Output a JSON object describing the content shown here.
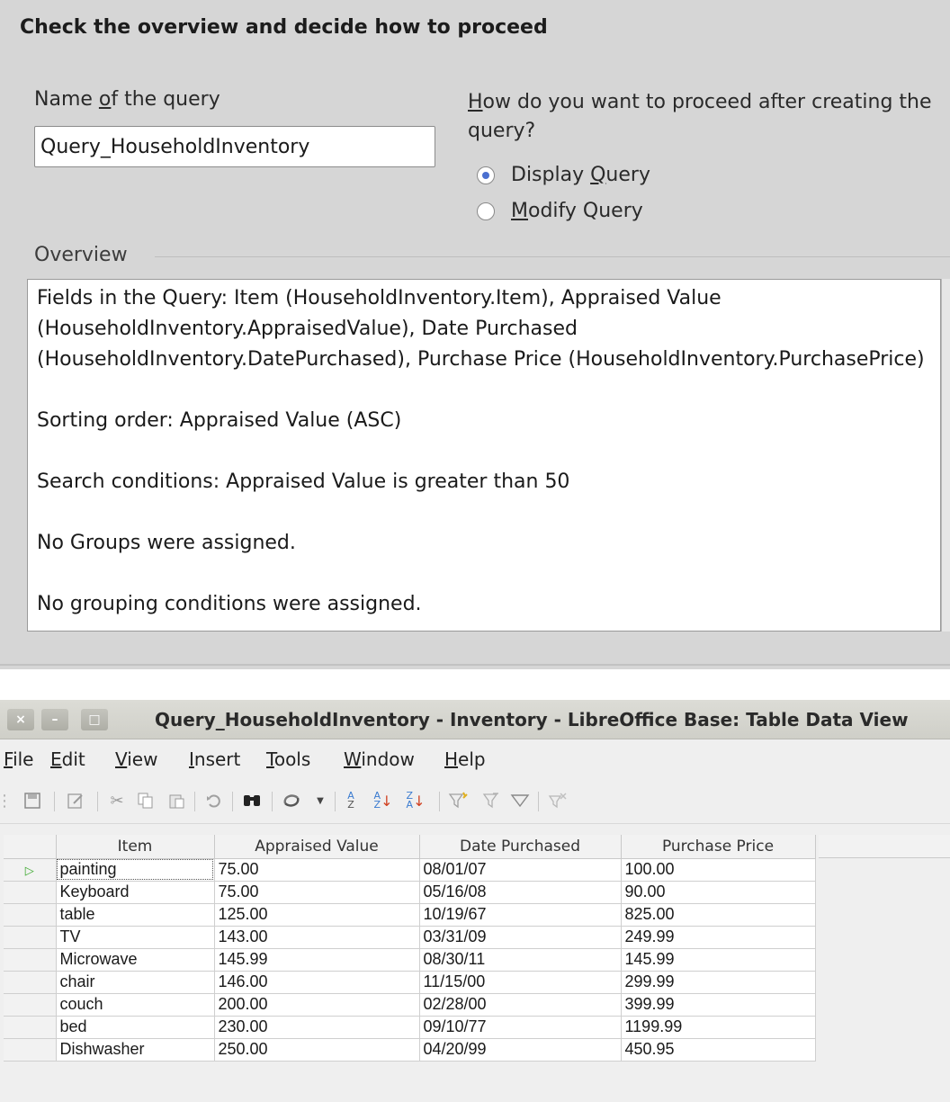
{
  "wizard": {
    "title": "Check the overview and decide how to proceed",
    "name_label_pre": "Name ",
    "name_label_mnemonic": "o",
    "name_label_post": "f the query",
    "query_name": "Query_HouseholdInventory",
    "proceed_question_mnemonic": "H",
    "proceed_question_rest": "ow do you want to proceed after creating the query?",
    "options": [
      {
        "pre": "Display ",
        "mnemonic": "Q",
        "post": "uery",
        "selected": true
      },
      {
        "pre": "",
        "mnemonic": "M",
        "post": "odify Query",
        "selected": false
      }
    ],
    "overview_label": "Overview",
    "overview_lines": [
      "Fields in the Query: Item (HouseholdInventory.Item), Appraised Value (HouseholdInventory.AppraisedValue), Date Purchased (HouseholdInventory.DatePurchased), Purchase Price (HouseholdInventory.PurchasePrice)",
      "Sorting order: Appraised Value (ASC)",
      "Search conditions: Appraised Value is greater than 50",
      "No Groups were assigned.",
      "No grouping conditions were assigned."
    ]
  },
  "window": {
    "title": "Query_HouseholdInventory - Inventory - LibreOffice Base: Table Data View",
    "buttons": {
      "close": "×",
      "minimize": "–",
      "maximize": "□"
    }
  },
  "menu": [
    {
      "mnemonic": "F",
      "rest": "ile"
    },
    {
      "mnemonic": "E",
      "rest": "dit"
    },
    {
      "mnemonic": "V",
      "rest": "iew"
    },
    {
      "mnemonic": "I",
      "rest": "nsert"
    },
    {
      "mnemonic": "T",
      "rest": "ools"
    },
    {
      "mnemonic": "W",
      "rest": "indow"
    },
    {
      "mnemonic": "H",
      "rest": "elp"
    }
  ],
  "toolbar_icons": [
    "save-icon",
    "edit-icon",
    "cut-icon",
    "copy-icon",
    "paste-icon",
    "undo-icon",
    "find-icon",
    "refresh-icon",
    "sort-ascending-icon",
    "sort-az-icon",
    "sort-za-icon",
    "autofilter-icon",
    "standard-filter-icon",
    "filter-icon",
    "remove-filter-icon"
  ],
  "grid": {
    "columns": [
      "Item",
      "Appraised Value",
      "Date Purchased",
      "Purchase Price"
    ],
    "rows": [
      [
        "painting",
        "75.00",
        "08/01/07",
        "100.00"
      ],
      [
        "Keyboard",
        "75.00",
        "05/16/08",
        "90.00"
      ],
      [
        "table",
        "125.00",
        "10/19/67",
        "825.00"
      ],
      [
        "TV",
        "143.00",
        "03/31/09",
        "249.99"
      ],
      [
        "Microwave",
        "145.99",
        "08/30/11",
        "145.99"
      ],
      [
        "chair",
        "146.00",
        "11/15/00",
        "299.99"
      ],
      [
        "couch",
        "200.00",
        "02/28/00",
        "399.99"
      ],
      [
        "bed",
        "230.00",
        "09/10/77",
        "1199.99"
      ],
      [
        "Dishwasher",
        "250.00",
        "04/20/99",
        "450.95"
      ]
    ],
    "current_row_marker": "▷"
  }
}
